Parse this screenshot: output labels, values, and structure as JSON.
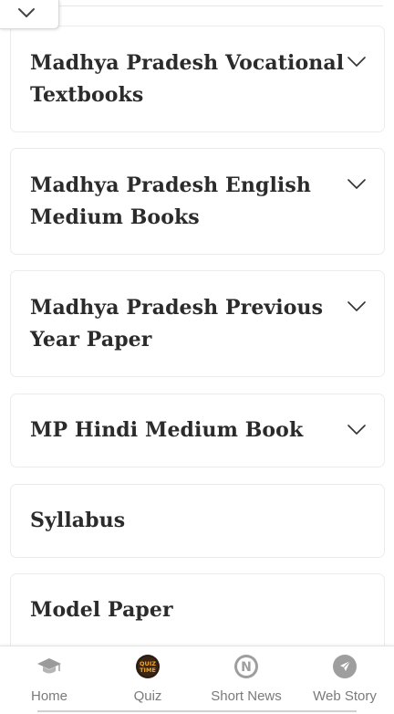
{
  "cards": [
    {
      "title": "Madhya Pradesh Vocational Textbooks",
      "expandable": true
    },
    {
      "title": "Madhya Pradesh English Medium Books",
      "expandable": true
    },
    {
      "title": "Madhya Pradesh Previous Year Paper",
      "expandable": true
    },
    {
      "title": "MP Hindi Medium Book",
      "expandable": true
    },
    {
      "title": "Syllabus",
      "expandable": false
    },
    {
      "title": "Model Paper",
      "expandable": false
    }
  ],
  "bottom_nav": {
    "items": [
      {
        "label": "Home",
        "icon": "graduation-cap-icon"
      },
      {
        "label": "Quiz",
        "icon": "quiz-time-icon",
        "icon_text": "QUIZ TIME"
      },
      {
        "label": "Short News",
        "icon": "news-n-icon",
        "icon_text": "N"
      },
      {
        "label": "Web Story",
        "icon": "send-arrow-icon"
      }
    ]
  },
  "colors": {
    "text": "#2b2b2b",
    "border": "#ececec",
    "nav_label": "#7a7a7a",
    "quiz_orange": "#f5a623"
  }
}
